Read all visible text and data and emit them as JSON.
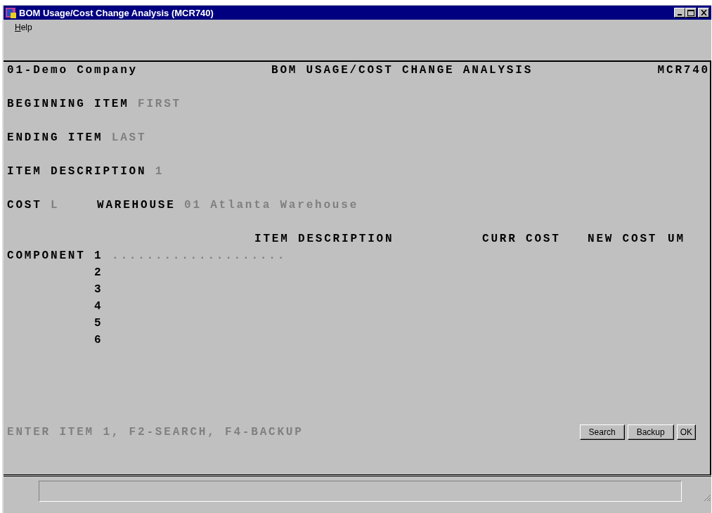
{
  "window": {
    "title": "BOM Usage/Cost Change Analysis (MCR740)"
  },
  "menu": [
    {
      "label": "Help"
    }
  ],
  "header": {
    "company": "01-Demo Company",
    "title": "BOM USAGE/COST CHANGE ANALYSIS",
    "program": "MCR740"
  },
  "fields": [
    {
      "label": "BEGINNING ITEM",
      "value": "FIRST"
    },
    {
      "label": "ENDING ITEM",
      "value": "LAST"
    },
    {
      "label": "ITEM DESCRIPTION",
      "value": "1"
    }
  ],
  "cost_line": [
    {
      "label": "COST",
      "value": "L"
    },
    {
      "label": "WAREHOUSE",
      "value": "01 Atlanta Warehouse"
    }
  ],
  "components": {
    "label": "COMPONENT",
    "columns": [
      "ITEM DESCRIPTION",
      "CURR COST",
      "NEW COST",
      "UM"
    ],
    "rows": [
      {
        "number": "1",
        "description": "...................."
      },
      {
        "number": "2"
      },
      {
        "number": "3"
      },
      {
        "number": "4"
      },
      {
        "number": "5"
      },
      {
        "number": "6"
      }
    ]
  },
  "prompt": "ENTER ITEM 1, F2-SEARCH, F4-BACKUP",
  "buttons": [
    "Search",
    "Backup",
    "OK"
  ]
}
